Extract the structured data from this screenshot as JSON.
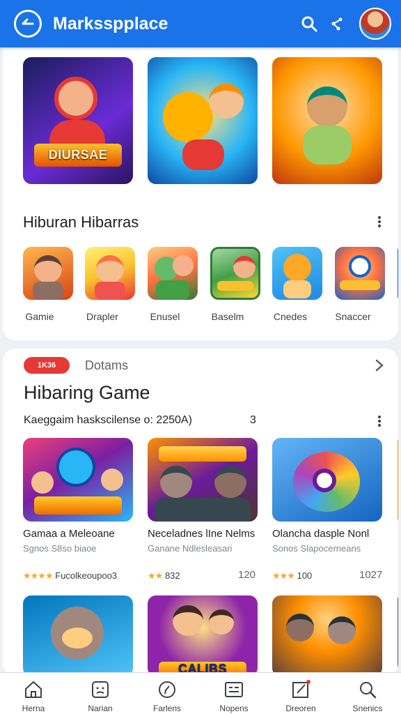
{
  "header": {
    "title": "Marksspplace",
    "back_icon": "back-arrow-icon",
    "search_icon": "search-icon",
    "share_icon": "share-icon",
    "avatar": "avatar"
  },
  "featured": {
    "tiles": [
      {
        "band_text": "DIURSAE",
        "colors": [
          "#1b1d5c",
          "#6a2bd6",
          "#ff4b4b"
        ]
      },
      {
        "band_text": "",
        "colors": [
          "#1e88e5",
          "#ffd54f",
          "#f57c00"
        ]
      },
      {
        "band_text": "",
        "colors": [
          "#f57c00",
          "#ffb74d",
          "#43a047"
        ]
      }
    ]
  },
  "section1": {
    "title": "Hiburan Hibarras",
    "items": [
      {
        "label": "Gamie",
        "colors": [
          "#d84315",
          "#ffb74d"
        ]
      },
      {
        "label": "Drapler",
        "colors": [
          "#fbc02d",
          "#e53935"
        ]
      },
      {
        "label": "Enusel",
        "colors": [
          "#2e7d32",
          "#ff7043"
        ]
      },
      {
        "label": "Baselm",
        "colors": [
          "#43a047",
          "#fdd835"
        ]
      },
      {
        "label": "Cnedes",
        "colors": [
          "#1e88e5",
          "#ffca28"
        ]
      },
      {
        "label": "Snaccer",
        "colors": [
          "#1565c0",
          "#ff7043"
        ]
      }
    ]
  },
  "card2": {
    "tag": "1K36",
    "kicker": "Dotams",
    "title": "Hibaring Game",
    "subtitle": "Kaeggaim haskscilense o: 2250A)",
    "subtitle_count": "3",
    "games": [
      {
        "name": "Gamaa a Meleoane",
        "sub": "Sgnos S8so biaoe",
        "stars": "★★★★",
        "rating": "Fucolkeoupoo3",
        "count": "",
        "colors": [
          "#7b1fa2",
          "#29b6f6",
          "#ffca28"
        ]
      },
      {
        "name": "Neceladnes lIne Nelms",
        "sub": "Ganane Ndlesleasari",
        "stars": "★★",
        "rating": "832",
        "count": "120",
        "colors": [
          "#4e342e",
          "#6a1b9a",
          "#ffa000"
        ]
      },
      {
        "name": "Olancha dasple Nonl",
        "sub": "Sonos Slapocerneans",
        "stars": "★★★",
        "rating": "100",
        "count": "1027",
        "colors": [
          "#1565c0",
          "#ef5350",
          "#66bb6a"
        ]
      }
    ],
    "row2": [
      {
        "colors": [
          "#0277bd",
          "#8d6e63",
          "#ffcc80"
        ]
      },
      {
        "band_text": "CALIBS",
        "colors": [
          "#8e24aa",
          "#ffb300",
          "#1e88e5"
        ]
      },
      {
        "colors": [
          "#5d4037",
          "#ff8f00",
          "#ffd180"
        ]
      }
    ]
  },
  "bottom_nav": [
    {
      "label": "Herna",
      "icon": "home-icon"
    },
    {
      "label": "Narian",
      "icon": "face-icon"
    },
    {
      "label": "Farlens",
      "icon": "compass-icon"
    },
    {
      "label": "Nopens",
      "icon": "list-card-icon"
    },
    {
      "label": "Dreoren",
      "icon": "edit-icon"
    },
    {
      "label": "Snenics",
      "icon": "search-icon"
    }
  ]
}
